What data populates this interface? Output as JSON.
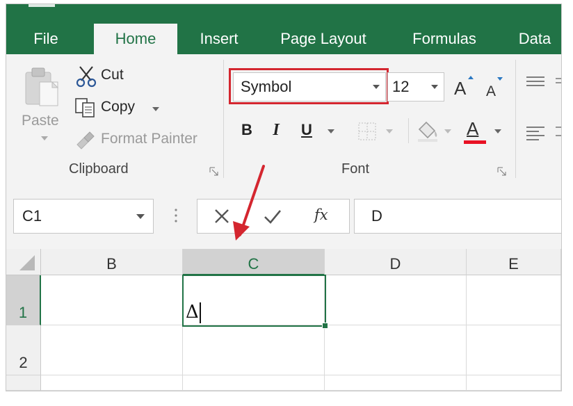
{
  "tabs": [
    {
      "label": "File",
      "active": false
    },
    {
      "label": "Home",
      "active": true
    },
    {
      "label": "Insert",
      "active": false
    },
    {
      "label": "Page Layout",
      "active": false
    },
    {
      "label": "Formulas",
      "active": false
    },
    {
      "label": "Data",
      "active": false
    }
  ],
  "clipboard": {
    "paste_label": "Paste",
    "cut_label": "Cut",
    "copy_label": "Copy",
    "format_painter_label": "Format Painter",
    "group_label": "Clipboard"
  },
  "font": {
    "font_name": "Symbol",
    "font_size": "12",
    "bold_label": "B",
    "italic_label": "I",
    "underline_label": "U",
    "font_color_label": "A",
    "font_color": "#e81123",
    "group_label": "Font"
  },
  "formula_bar": {
    "name_box": "C1",
    "fx_label": "fx",
    "value": "D"
  },
  "grid": {
    "columns": [
      "B",
      "C",
      "D",
      "E"
    ],
    "rows": [
      "1",
      "2"
    ],
    "active_cell_text": "Δ"
  },
  "colors": {
    "accent": "#217346",
    "highlight": "#d4262f"
  }
}
